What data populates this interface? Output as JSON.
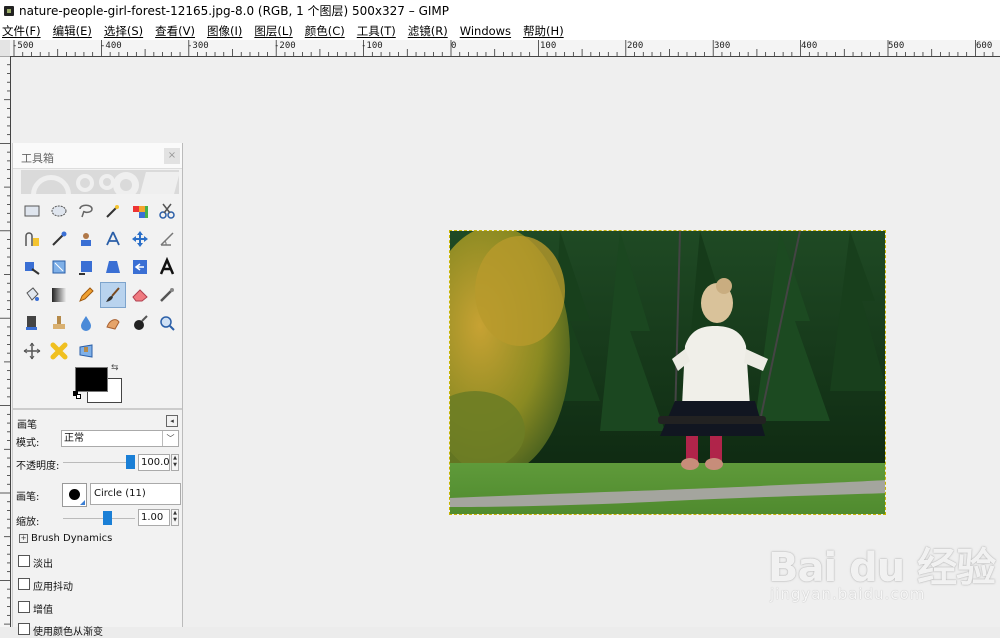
{
  "window": {
    "title": "nature-people-girl-forest-12165.jpg-8.0 (RGB, 1 个图层) 500x327 – GIMP",
    "icon": "gimp-app-icon"
  },
  "menubar": {
    "items": [
      "文件(F)",
      "编辑(E)",
      "选择(S)",
      "查看(V)",
      "图像(I)",
      "图层(L)",
      "颜色(C)",
      "工具(T)",
      "滤镜(R)",
      "Windows",
      "帮助(H)"
    ]
  },
  "ruler": {
    "labels": [
      "-500",
      "-400",
      "-300",
      "-200",
      "-100",
      "0",
      "100",
      "200",
      "300",
      "400",
      "500",
      "600"
    ]
  },
  "toolbox": {
    "title": "工具箱",
    "close_label": "×",
    "active_tool": "paintbrush",
    "tools": [
      "rect-select-icon",
      "ellipse-select-icon",
      "lasso-icon",
      "fuzzy-select-icon",
      "select-by-color-icon",
      "scissors-icon",
      "foreground-select-icon",
      "paths-icon",
      "color-picker-icon",
      "zoom-person-icon",
      "measure-icon",
      "move-icon",
      "align-icon",
      "crop-icon",
      "rotate-icon",
      "scale-icon",
      "shear-icon",
      "perspective-icon",
      "flip-icon",
      "text-icon",
      "bucket-fill-icon",
      "blend-icon",
      "pencil-icon",
      "paintbrush-icon",
      "eraser-icon",
      "airbrush-icon",
      "ink-icon",
      "clone-icon",
      "heal-icon",
      "smudge-icon",
      "dodge-burn-icon",
      "magnify-icon",
      "cage-transform-icon",
      "warp-icon",
      "perspective-clone-icon"
    ],
    "colors": {
      "foreground": "#000000",
      "background": "#ffffff"
    }
  },
  "tool_options": {
    "title": "画笔",
    "mode_label": "模式:",
    "mode_value": "正常",
    "opacity_label": "不透明度:",
    "opacity_value": "100.0",
    "opacity_fraction": 1.0,
    "brush_label": "画笔:",
    "brush_value": "Circle (11)",
    "scale_label": "缩放:",
    "scale_value": "1.00",
    "brush_dynamics_label": "Brush Dynamics",
    "checkboxes": [
      "淡出",
      "应用抖动",
      "增值",
      "使用颜色从渐变"
    ]
  },
  "watermark": {
    "logo_text": "Bai  du 经验",
    "url": "jingyan.baidu.com"
  },
  "colors": {
    "selection_border": "#c8b400",
    "active_tool_bg": "#b9d3ee",
    "slider_handle": "#1a7fd6"
  }
}
